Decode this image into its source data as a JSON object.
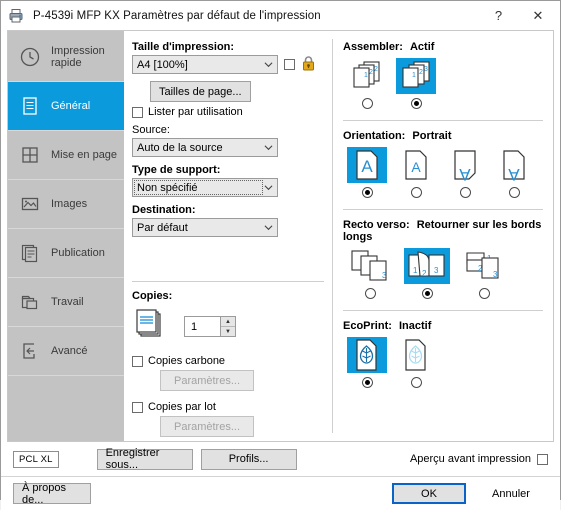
{
  "window": {
    "title": "P-4539i MFP KX Paramètres par défaut de l'impression",
    "icon": "printer-icon",
    "help_label": "?",
    "close_label": "✕"
  },
  "sidebar": {
    "items": [
      {
        "label": "Impression rapide",
        "icon": "clock-icon",
        "selected": false
      },
      {
        "label": "Général",
        "icon": "document-icon",
        "selected": true
      },
      {
        "label": "Mise en page",
        "icon": "grid-icon",
        "selected": false
      },
      {
        "label": "Images",
        "icon": "picture-icon",
        "selected": false
      },
      {
        "label": "Publication",
        "icon": "stacked-pages-icon",
        "selected": false
      },
      {
        "label": "Travail",
        "icon": "job-folder-icon",
        "selected": false
      },
      {
        "label": "Avancé",
        "icon": "arrow-into-page-icon",
        "selected": false
      }
    ]
  },
  "left_panel": {
    "print_size": {
      "label": "Taille d'impression:",
      "value": "A4 [100%]",
      "checkbox_checked": false,
      "lock_icon": "padlock-icon"
    },
    "page_sizes_button": "Tailles de page...",
    "list_by_use": {
      "label": "Lister par utilisation",
      "checked": false
    },
    "source": {
      "label": "Source:",
      "value": "Auto de la source"
    },
    "media_type": {
      "label": "Type de support:",
      "value": "Non spécifié",
      "focused": true
    },
    "destination": {
      "label": "Destination:",
      "value": "Par défaut"
    },
    "copies": {
      "label": "Copies:",
      "value": "1",
      "up_arrow": "▲",
      "down_arrow": "▼",
      "icon": "stacked-copies-icon"
    },
    "carbon_copies": {
      "label": "Copies carbone",
      "checked": false,
      "settings_button": "Paramètres..."
    },
    "batch_copies": {
      "label": "Copies par lot",
      "checked": false,
      "settings_button": "Paramètres..."
    }
  },
  "right_panel": {
    "collate": {
      "title": "Assembler:",
      "value": "Actif",
      "options": [
        {
          "name": "collate-off-icon",
          "selected": false
        },
        {
          "name": "collate-on-icon",
          "selected": true
        }
      ]
    },
    "orientation": {
      "title": "Orientation:",
      "value": "Portrait",
      "options": [
        {
          "name": "portrait-icon",
          "selected": true
        },
        {
          "name": "portrait-rotated-icon",
          "selected": false
        },
        {
          "name": "landscape-icon",
          "selected": false
        },
        {
          "name": "landscape-rotated-icon",
          "selected": false
        }
      ]
    },
    "duplex": {
      "title": "Recto verso:",
      "value": "Retourner sur les bords longs",
      "options": [
        {
          "name": "duplex-off-icon",
          "selected": false
        },
        {
          "name": "duplex-long-edge-icon",
          "selected": true
        },
        {
          "name": "duplex-short-edge-icon",
          "selected": false
        }
      ]
    },
    "ecoprint": {
      "title": "EcoPrint:",
      "value": "Inactif",
      "options": [
        {
          "name": "ecoprint-off-icon",
          "selected": true
        },
        {
          "name": "ecoprint-on-icon",
          "selected": false
        }
      ]
    }
  },
  "footer": {
    "pcl_badge": "PCL XL",
    "save_as_button": "Enregistrer sous...",
    "profiles_button": "Profils...",
    "print_preview": {
      "label": "Aperçu avant impression",
      "checked": false
    },
    "about_button": "À propos de...",
    "ok_button": "OK",
    "cancel_button": "Annuler"
  },
  "colors": {
    "accent": "#0b9bdc",
    "sidebar_bg": "#c3c3c3",
    "default_button_border": "#0a64c8"
  }
}
